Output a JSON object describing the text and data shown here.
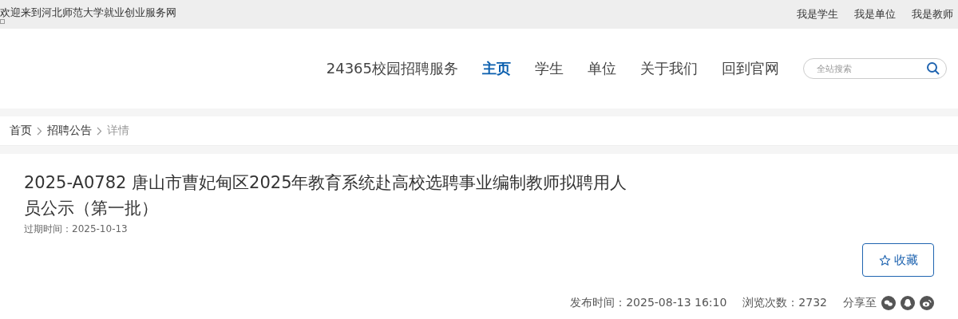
{
  "top_bar": {
    "welcome": "欢迎来到河北师范大学就业创业服务网",
    "links": [
      "我是学生",
      "我是单位",
      "我是教师"
    ]
  },
  "nav": {
    "items": [
      {
        "label": "24365校园招聘服务",
        "selected": false
      },
      {
        "label": "主页",
        "selected": true
      },
      {
        "label": "学生",
        "selected": false
      },
      {
        "label": "单位",
        "selected": false
      },
      {
        "label": "关于我们",
        "selected": false
      },
      {
        "label": "回到官网",
        "selected": false
      }
    ],
    "search": {
      "placeholder": "全站搜索"
    }
  },
  "breadcrumb": [
    {
      "label": "首页",
      "current": false
    },
    {
      "label": "招聘公告",
      "current": false
    },
    {
      "label": "详情",
      "current": true
    }
  ],
  "article": {
    "title": "2025-A0782 唐山市曹妃甸区2025年教育系统赴高校选聘事业编制教师拟聘用人员公示（第一批）",
    "expiry": "过期时间：2025-10-13",
    "favorite_button": "收藏",
    "published": "发布时间：2025-08-13 16:10",
    "views": "浏览次数：2732",
    "share_label": "分享至"
  }
}
